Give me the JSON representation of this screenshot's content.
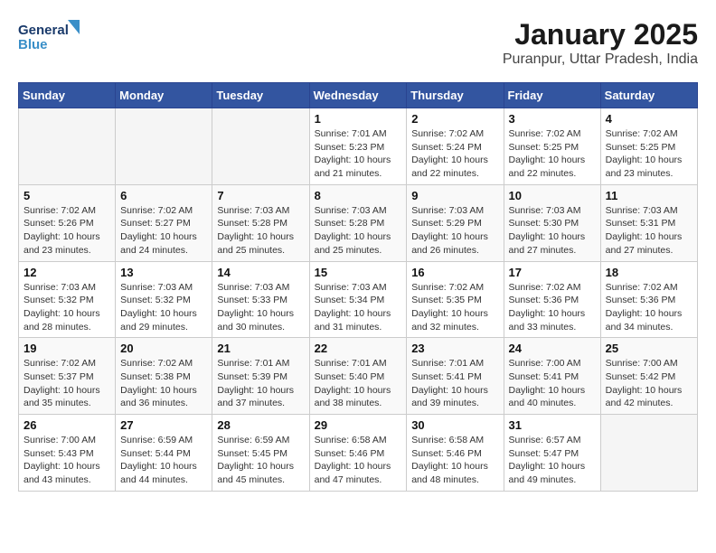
{
  "header": {
    "logo_line1": "General",
    "logo_line2": "Blue",
    "title": "January 2025",
    "subtitle": "Puranpur, Uttar Pradesh, India"
  },
  "days_of_week": [
    "Sunday",
    "Monday",
    "Tuesday",
    "Wednesday",
    "Thursday",
    "Friday",
    "Saturday"
  ],
  "weeks": [
    [
      {
        "day": "",
        "sunrise": "",
        "sunset": "",
        "daylight": ""
      },
      {
        "day": "",
        "sunrise": "",
        "sunset": "",
        "daylight": ""
      },
      {
        "day": "",
        "sunrise": "",
        "sunset": "",
        "daylight": ""
      },
      {
        "day": "1",
        "sunrise": "Sunrise: 7:01 AM",
        "sunset": "Sunset: 5:23 PM",
        "daylight": "Daylight: 10 hours and 21 minutes."
      },
      {
        "day": "2",
        "sunrise": "Sunrise: 7:02 AM",
        "sunset": "Sunset: 5:24 PM",
        "daylight": "Daylight: 10 hours and 22 minutes."
      },
      {
        "day": "3",
        "sunrise": "Sunrise: 7:02 AM",
        "sunset": "Sunset: 5:25 PM",
        "daylight": "Daylight: 10 hours and 22 minutes."
      },
      {
        "day": "4",
        "sunrise": "Sunrise: 7:02 AM",
        "sunset": "Sunset: 5:25 PM",
        "daylight": "Daylight: 10 hours and 23 minutes."
      }
    ],
    [
      {
        "day": "5",
        "sunrise": "Sunrise: 7:02 AM",
        "sunset": "Sunset: 5:26 PM",
        "daylight": "Daylight: 10 hours and 23 minutes."
      },
      {
        "day": "6",
        "sunrise": "Sunrise: 7:02 AM",
        "sunset": "Sunset: 5:27 PM",
        "daylight": "Daylight: 10 hours and 24 minutes."
      },
      {
        "day": "7",
        "sunrise": "Sunrise: 7:03 AM",
        "sunset": "Sunset: 5:28 PM",
        "daylight": "Daylight: 10 hours and 25 minutes."
      },
      {
        "day": "8",
        "sunrise": "Sunrise: 7:03 AM",
        "sunset": "Sunset: 5:28 PM",
        "daylight": "Daylight: 10 hours and 25 minutes."
      },
      {
        "day": "9",
        "sunrise": "Sunrise: 7:03 AM",
        "sunset": "Sunset: 5:29 PM",
        "daylight": "Daylight: 10 hours and 26 minutes."
      },
      {
        "day": "10",
        "sunrise": "Sunrise: 7:03 AM",
        "sunset": "Sunset: 5:30 PM",
        "daylight": "Daylight: 10 hours and 27 minutes."
      },
      {
        "day": "11",
        "sunrise": "Sunrise: 7:03 AM",
        "sunset": "Sunset: 5:31 PM",
        "daylight": "Daylight: 10 hours and 27 minutes."
      }
    ],
    [
      {
        "day": "12",
        "sunrise": "Sunrise: 7:03 AM",
        "sunset": "Sunset: 5:32 PM",
        "daylight": "Daylight: 10 hours and 28 minutes."
      },
      {
        "day": "13",
        "sunrise": "Sunrise: 7:03 AM",
        "sunset": "Sunset: 5:32 PM",
        "daylight": "Daylight: 10 hours and 29 minutes."
      },
      {
        "day": "14",
        "sunrise": "Sunrise: 7:03 AM",
        "sunset": "Sunset: 5:33 PM",
        "daylight": "Daylight: 10 hours and 30 minutes."
      },
      {
        "day": "15",
        "sunrise": "Sunrise: 7:03 AM",
        "sunset": "Sunset: 5:34 PM",
        "daylight": "Daylight: 10 hours and 31 minutes."
      },
      {
        "day": "16",
        "sunrise": "Sunrise: 7:02 AM",
        "sunset": "Sunset: 5:35 PM",
        "daylight": "Daylight: 10 hours and 32 minutes."
      },
      {
        "day": "17",
        "sunrise": "Sunrise: 7:02 AM",
        "sunset": "Sunset: 5:36 PM",
        "daylight": "Daylight: 10 hours and 33 minutes."
      },
      {
        "day": "18",
        "sunrise": "Sunrise: 7:02 AM",
        "sunset": "Sunset: 5:36 PM",
        "daylight": "Daylight: 10 hours and 34 minutes."
      }
    ],
    [
      {
        "day": "19",
        "sunrise": "Sunrise: 7:02 AM",
        "sunset": "Sunset: 5:37 PM",
        "daylight": "Daylight: 10 hours and 35 minutes."
      },
      {
        "day": "20",
        "sunrise": "Sunrise: 7:02 AM",
        "sunset": "Sunset: 5:38 PM",
        "daylight": "Daylight: 10 hours and 36 minutes."
      },
      {
        "day": "21",
        "sunrise": "Sunrise: 7:01 AM",
        "sunset": "Sunset: 5:39 PM",
        "daylight": "Daylight: 10 hours and 37 minutes."
      },
      {
        "day": "22",
        "sunrise": "Sunrise: 7:01 AM",
        "sunset": "Sunset: 5:40 PM",
        "daylight": "Daylight: 10 hours and 38 minutes."
      },
      {
        "day": "23",
        "sunrise": "Sunrise: 7:01 AM",
        "sunset": "Sunset: 5:41 PM",
        "daylight": "Daylight: 10 hours and 39 minutes."
      },
      {
        "day": "24",
        "sunrise": "Sunrise: 7:00 AM",
        "sunset": "Sunset: 5:41 PM",
        "daylight": "Daylight: 10 hours and 40 minutes."
      },
      {
        "day": "25",
        "sunrise": "Sunrise: 7:00 AM",
        "sunset": "Sunset: 5:42 PM",
        "daylight": "Daylight: 10 hours and 42 minutes."
      }
    ],
    [
      {
        "day": "26",
        "sunrise": "Sunrise: 7:00 AM",
        "sunset": "Sunset: 5:43 PM",
        "daylight": "Daylight: 10 hours and 43 minutes."
      },
      {
        "day": "27",
        "sunrise": "Sunrise: 6:59 AM",
        "sunset": "Sunset: 5:44 PM",
        "daylight": "Daylight: 10 hours and 44 minutes."
      },
      {
        "day": "28",
        "sunrise": "Sunrise: 6:59 AM",
        "sunset": "Sunset: 5:45 PM",
        "daylight": "Daylight: 10 hours and 45 minutes."
      },
      {
        "day": "29",
        "sunrise": "Sunrise: 6:58 AM",
        "sunset": "Sunset: 5:46 PM",
        "daylight": "Daylight: 10 hours and 47 minutes."
      },
      {
        "day": "30",
        "sunrise": "Sunrise: 6:58 AM",
        "sunset": "Sunset: 5:46 PM",
        "daylight": "Daylight: 10 hours and 48 minutes."
      },
      {
        "day": "31",
        "sunrise": "Sunrise: 6:57 AM",
        "sunset": "Sunset: 5:47 PM",
        "daylight": "Daylight: 10 hours and 49 minutes."
      },
      {
        "day": "",
        "sunrise": "",
        "sunset": "",
        "daylight": ""
      }
    ]
  ]
}
